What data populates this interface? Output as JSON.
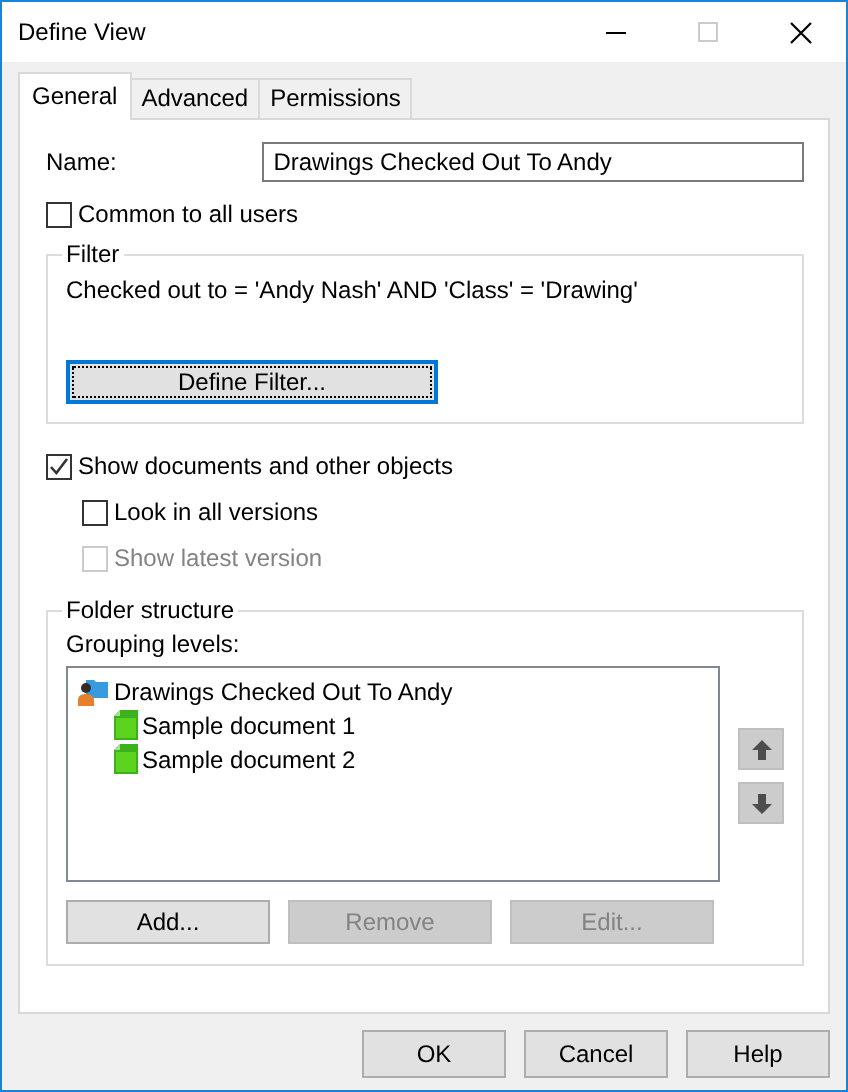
{
  "window": {
    "title": "Define View",
    "maximize_disabled": true
  },
  "tabs": [
    {
      "label": "General",
      "selected": true
    },
    {
      "label": "Advanced",
      "selected": false
    },
    {
      "label": "Permissions",
      "selected": false
    }
  ],
  "name_field": {
    "label": "Name:",
    "value": "Drawings Checked Out To Andy"
  },
  "common_option": {
    "label": "Common to all users",
    "checked": false
  },
  "filter": {
    "title": "Filter",
    "expression": "Checked out to = 'Andy Nash' AND 'Class' = 'Drawing'",
    "button": {
      "label": "Define Filter...",
      "focused": true
    }
  },
  "show_documents": {
    "label": "Show documents and other objects",
    "checked": true,
    "children": [
      {
        "label": "Look in all versions",
        "checked": false,
        "disabled": false
      },
      {
        "label": "Show latest version",
        "checked": false,
        "disabled": true
      }
    ]
  },
  "folder_structure": {
    "title": "Folder structure",
    "list_label": "Grouping levels:",
    "tree": [
      {
        "kind": "view",
        "label": "Drawings Checked Out To Andy",
        "children": [
          {
            "kind": "document",
            "label": "Sample document 1"
          },
          {
            "kind": "document",
            "label": "Sample document 2"
          }
        ]
      }
    ],
    "move_buttons": [
      {
        "kind": "up"
      },
      {
        "kind": "down"
      }
    ],
    "buttons": [
      {
        "label": "Add...",
        "disabled": false
      },
      {
        "label": "Remove",
        "disabled": true
      },
      {
        "label": "Edit...",
        "disabled": true
      }
    ]
  },
  "footer_buttons": [
    {
      "label": "OK"
    },
    {
      "label": "Cancel"
    },
    {
      "label": "Help"
    }
  ]
}
